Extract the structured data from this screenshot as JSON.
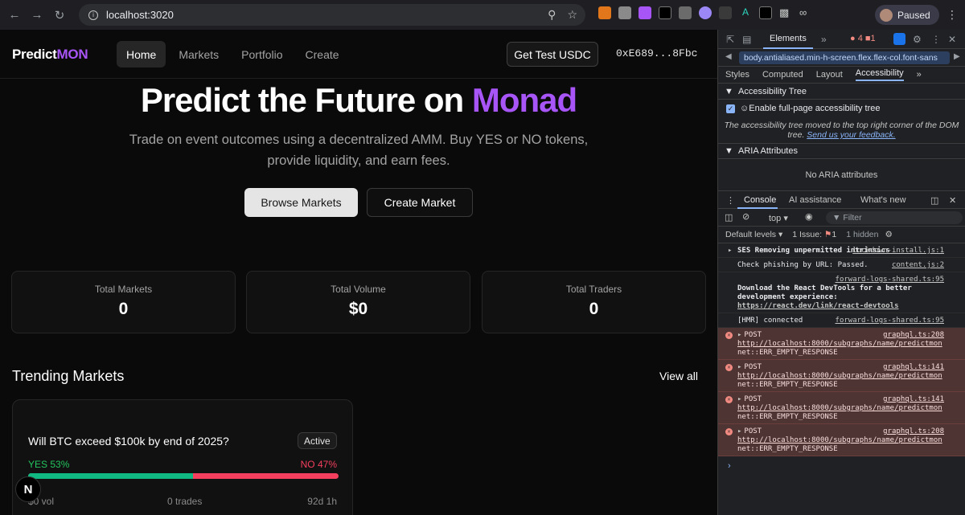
{
  "browser": {
    "url": "localhost:3020",
    "profile_label": "Paused"
  },
  "app": {
    "logo": {
      "part1": "Predict",
      "part2": "MON"
    },
    "nav": [
      {
        "label": "Home"
      },
      {
        "label": "Markets"
      },
      {
        "label": "Portfolio"
      },
      {
        "label": "Create"
      }
    ],
    "get_usdc_label": "Get Test USDC",
    "wallet_address": "0xE689...8Fbc",
    "hero": {
      "title_main": "Predict the Future on ",
      "title_accent": "Monad",
      "subtitle": "Trade on event outcomes using a decentralized AMM. Buy YES or NO tokens, provide liquidity, and earn fees.",
      "browse_label": "Browse Markets",
      "create_label": "Create Market"
    },
    "stats": [
      {
        "label": "Total Markets",
        "value": "0"
      },
      {
        "label": "Total Volume",
        "value": "$0"
      },
      {
        "label": "Total Traders",
        "value": "0"
      }
    ],
    "trending_title": "Trending Markets",
    "view_all_label": "View all",
    "market_card": {
      "question": "Will BTC exceed $100k by end of 2025?",
      "status": "Active",
      "yes_label": "YES 53%",
      "no_label": "NO 47%",
      "yes_fraction": 0.53,
      "volume": "$0 vol",
      "trades": "0 trades",
      "time_left": "92d 1h"
    },
    "next_badge": "N"
  },
  "devtools": {
    "main_tab": "Elements",
    "error_count": "4",
    "issue_count": "1",
    "breadcrumb": "body.antialiased.min-h-screen.flex.flex-col.font-sans",
    "subtabs": [
      "Styles",
      "Computed",
      "Layout",
      "Accessibility"
    ],
    "accessibility_tree_title": "Accessibility Tree",
    "enable_tree_label": "Enable full-page accessibility tree",
    "tree_note": "The accessibility tree moved to the top right corner of the DOM tree.",
    "feedback_link": "Send us your feedback.",
    "aria_title": "ARIA Attributes",
    "no_aria": "No ARIA attributes",
    "console_tabs": [
      "Console",
      "AI assistance",
      "What's new"
    ],
    "context": "top",
    "filter_placeholder": "Filter",
    "default_levels": "Default levels",
    "issues_label": "1 Issue:",
    "issues_count": "1",
    "hidden_label": "1 hidden",
    "logs": [
      {
        "text": "SES Removing unpermitted intrinsics",
        "src": "lockdown-install.js:1",
        "type": "info"
      },
      {
        "text": "Check phishing by URL: Passed.",
        "src": "content.js:2",
        "type": "info"
      },
      {
        "src2": "forward-logs-shared.ts:95",
        "text": "Download the React DevTools for a better development experience:",
        "link": "https://react.dev/link/react-devtools",
        "type": "info"
      },
      {
        "text": "[HMR] connected",
        "src": "forward-logs-shared.ts:95",
        "type": "info"
      },
      {
        "text": "POST",
        "src": "graphql.ts:208",
        "url": "http://localhost:8000/subgraphs/name/predictmon",
        "error": "net::ERR_EMPTY_RESPONSE",
        "type": "error"
      },
      {
        "text": "POST",
        "src": "graphql.ts:141",
        "url": "http://localhost:8000/subgraphs/name/predictmon",
        "error": "net::ERR_EMPTY_RESPONSE",
        "type": "error"
      },
      {
        "text": "POST",
        "src": "graphql.ts:141",
        "url": "http://localhost:8000/subgraphs/name/predictmon",
        "error": "net::ERR_EMPTY_RESPONSE",
        "type": "error"
      },
      {
        "text": "POST",
        "src": "graphql.ts:208",
        "url": "http://localhost:8000/subgraphs/name/predictmon",
        "error": "net::ERR_EMPTY_RESPONSE",
        "type": "error"
      }
    ]
  },
  "colors": {
    "accent": "#a855f7",
    "yes": "#22c55e",
    "no": "#f43f5e"
  }
}
